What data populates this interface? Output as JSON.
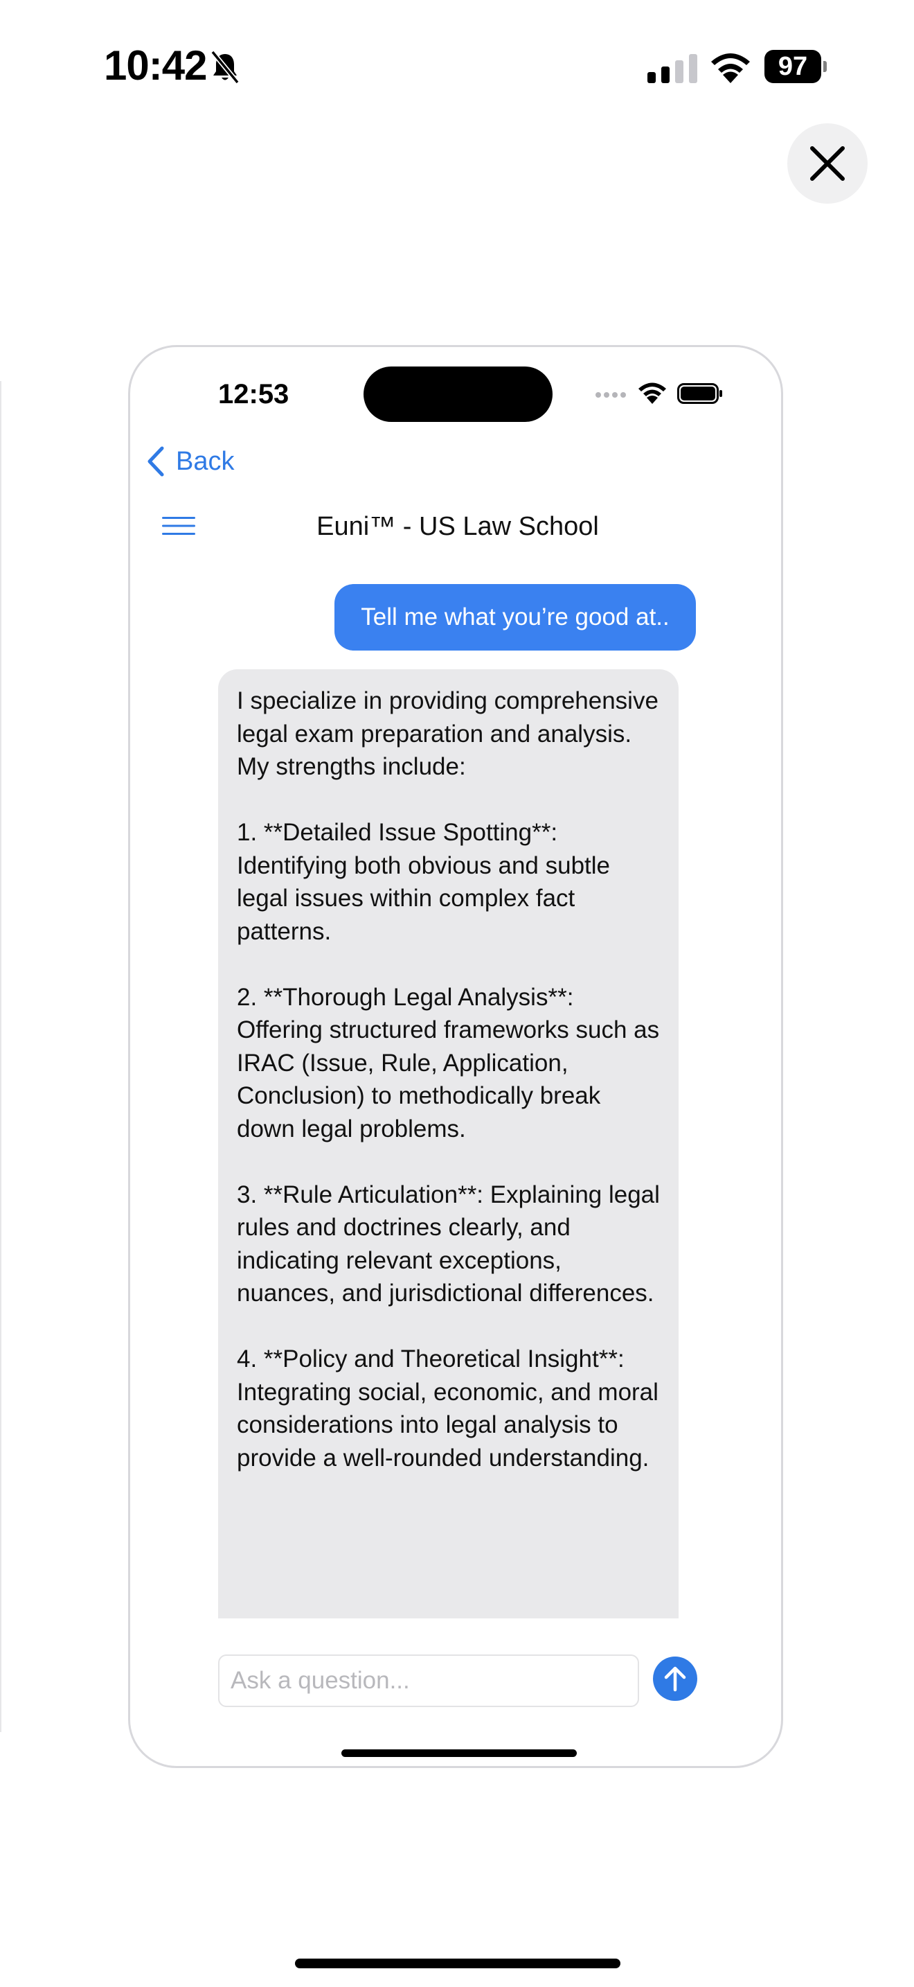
{
  "device_status": {
    "time": "10:42",
    "battery": "97",
    "icons": [
      "bell-slash-icon",
      "cellular-signal-icon",
      "wifi-icon",
      "battery-icon"
    ]
  },
  "close_button": {
    "icon": "close-x-icon"
  },
  "phone_preview": {
    "status": {
      "time": "12:53",
      "icons": [
        "signal-dots-icon",
        "wifi-icon",
        "battery-icon"
      ]
    },
    "nav": {
      "back_label": "Back",
      "back_icon": "chevron-left-icon",
      "menu_icon": "hamburger-menu-icon",
      "title": "Euni™ - US Law School"
    },
    "messages": {
      "user": "Tell me what you’re good at..",
      "assistant": [
        "I specialize in providing comprehensive legal exam preparation and analysis. My strengths include:",
        "1. **Detailed Issue Spotting**: Identifying both obvious and subtle legal issues within complex fact patterns.",
        "2. **Thorough Legal Analysis**: Offering structured frameworks such as IRAC (Issue, Rule, Application, Conclusion) to methodically break down legal problems.",
        "3. **Rule Articulation**: Explaining legal rules and doctrines clearly, and indicating relevant exceptions, nuances, and jurisdictional differences.",
        "4. **Policy and Theoretical Insight**: Integrating social, economic, and moral considerations into legal analysis to provide a well-rounded understanding."
      ]
    },
    "composer": {
      "placeholder": "Ask a question...",
      "value": "",
      "send_icon": "arrow-up-icon"
    }
  },
  "colors": {
    "accent": "#2f7ae5",
    "user_bubble": "#3a81f0",
    "assistant_bubble": "#e9e9eb",
    "close_button_bg": "#f0f0f1"
  }
}
